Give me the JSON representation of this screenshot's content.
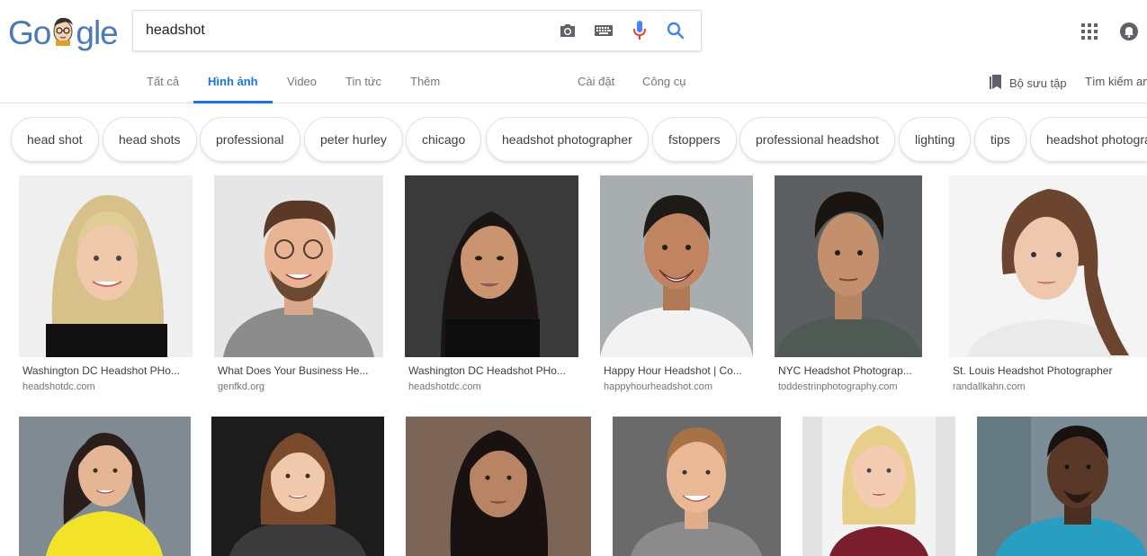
{
  "search": {
    "query": "headshot"
  },
  "header": {
    "logo_text": "Google",
    "logo_letters": [
      "G",
      "o",
      "o",
      "g",
      "l",
      "e"
    ],
    "logo_colors": [
      "#4285f4",
      "#ea4335",
      "#fbbc05",
      "#4285f4",
      "#34a853",
      "#ea4335"
    ],
    "icons": [
      "camera-icon",
      "keyboard-icon",
      "mic-icon",
      "search-icon",
      "apps-icon",
      "bell-icon"
    ]
  },
  "tabs": {
    "all": "Tất cả",
    "images": "Hình ảnh",
    "video": "Video",
    "news": "Tin tức",
    "more": "Thêm",
    "settings": "Cài đặt",
    "tools": "Công cụ",
    "saved": "Bộ sưu tập",
    "safesearch": "Tìm kiếm an"
  },
  "chips": [
    "head shot",
    "head shots",
    "professional",
    "peter hurley",
    "chicago",
    "headshot photographer",
    "fstoppers",
    "professional headshot",
    "lighting",
    "tips",
    "headshot photogra"
  ],
  "results_row1": [
    {
      "title": "Washington DC Headshot PHo...",
      "domain": "headshotdc.com"
    },
    {
      "title": "What Does Your Business He...",
      "domain": "genfkd.org"
    },
    {
      "title": "Washington DC Headshot PHo...",
      "domain": "headshotdc.com"
    },
    {
      "title": "Happy Hour Headshot | Co...",
      "domain": "happyhourheadshot.com"
    },
    {
      "title": "NYC Headshot Photograp...",
      "domain": "toddestrinphotography.com"
    },
    {
      "title": "St. Louis Headshot Photographer",
      "domain": "randallkahn.com"
    }
  ],
  "colors": {
    "accent": "#1a73e8",
    "mic_blue": "#4285f4",
    "mic_red": "#ea4335"
  }
}
